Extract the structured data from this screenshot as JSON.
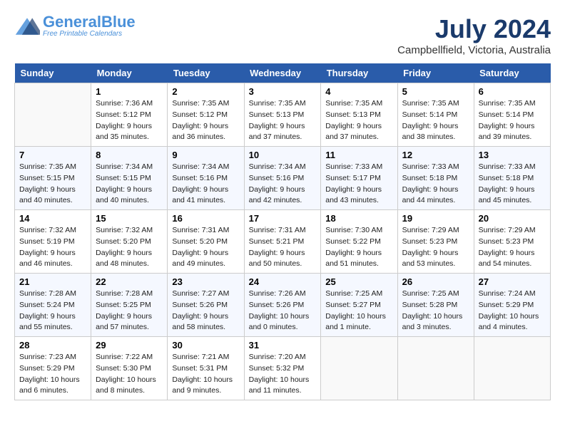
{
  "logo": {
    "text_general": "General",
    "text_blue": "Blue",
    "icon_color": "#4a90d9"
  },
  "title": {
    "month_year": "July 2024",
    "location": "Campbellfield, Victoria, Australia"
  },
  "days_of_week": [
    "Sunday",
    "Monday",
    "Tuesday",
    "Wednesday",
    "Thursday",
    "Friday",
    "Saturday"
  ],
  "weeks": [
    [
      {
        "day": "",
        "sunrise": "",
        "sunset": "",
        "daylight": ""
      },
      {
        "day": "1",
        "sunrise": "Sunrise: 7:36 AM",
        "sunset": "Sunset: 5:12 PM",
        "daylight": "Daylight: 9 hours and 35 minutes."
      },
      {
        "day": "2",
        "sunrise": "Sunrise: 7:35 AM",
        "sunset": "Sunset: 5:12 PM",
        "daylight": "Daylight: 9 hours and 36 minutes."
      },
      {
        "day": "3",
        "sunrise": "Sunrise: 7:35 AM",
        "sunset": "Sunset: 5:13 PM",
        "daylight": "Daylight: 9 hours and 37 minutes."
      },
      {
        "day": "4",
        "sunrise": "Sunrise: 7:35 AM",
        "sunset": "Sunset: 5:13 PM",
        "daylight": "Daylight: 9 hours and 37 minutes."
      },
      {
        "day": "5",
        "sunrise": "Sunrise: 7:35 AM",
        "sunset": "Sunset: 5:14 PM",
        "daylight": "Daylight: 9 hours and 38 minutes."
      },
      {
        "day": "6",
        "sunrise": "Sunrise: 7:35 AM",
        "sunset": "Sunset: 5:14 PM",
        "daylight": "Daylight: 9 hours and 39 minutes."
      }
    ],
    [
      {
        "day": "7",
        "sunrise": "Sunrise: 7:35 AM",
        "sunset": "Sunset: 5:15 PM",
        "daylight": "Daylight: 9 hours and 40 minutes."
      },
      {
        "day": "8",
        "sunrise": "Sunrise: 7:34 AM",
        "sunset": "Sunset: 5:15 PM",
        "daylight": "Daylight: 9 hours and 40 minutes."
      },
      {
        "day": "9",
        "sunrise": "Sunrise: 7:34 AM",
        "sunset": "Sunset: 5:16 PM",
        "daylight": "Daylight: 9 hours and 41 minutes."
      },
      {
        "day": "10",
        "sunrise": "Sunrise: 7:34 AM",
        "sunset": "Sunset: 5:16 PM",
        "daylight": "Daylight: 9 hours and 42 minutes."
      },
      {
        "day": "11",
        "sunrise": "Sunrise: 7:33 AM",
        "sunset": "Sunset: 5:17 PM",
        "daylight": "Daylight: 9 hours and 43 minutes."
      },
      {
        "day": "12",
        "sunrise": "Sunrise: 7:33 AM",
        "sunset": "Sunset: 5:18 PM",
        "daylight": "Daylight: 9 hours and 44 minutes."
      },
      {
        "day": "13",
        "sunrise": "Sunrise: 7:33 AM",
        "sunset": "Sunset: 5:18 PM",
        "daylight": "Daylight: 9 hours and 45 minutes."
      }
    ],
    [
      {
        "day": "14",
        "sunrise": "Sunrise: 7:32 AM",
        "sunset": "Sunset: 5:19 PM",
        "daylight": "Daylight: 9 hours and 46 minutes."
      },
      {
        "day": "15",
        "sunrise": "Sunrise: 7:32 AM",
        "sunset": "Sunset: 5:20 PM",
        "daylight": "Daylight: 9 hours and 48 minutes."
      },
      {
        "day": "16",
        "sunrise": "Sunrise: 7:31 AM",
        "sunset": "Sunset: 5:20 PM",
        "daylight": "Daylight: 9 hours and 49 minutes."
      },
      {
        "day": "17",
        "sunrise": "Sunrise: 7:31 AM",
        "sunset": "Sunset: 5:21 PM",
        "daylight": "Daylight: 9 hours and 50 minutes."
      },
      {
        "day": "18",
        "sunrise": "Sunrise: 7:30 AM",
        "sunset": "Sunset: 5:22 PM",
        "daylight": "Daylight: 9 hours and 51 minutes."
      },
      {
        "day": "19",
        "sunrise": "Sunrise: 7:29 AM",
        "sunset": "Sunset: 5:23 PM",
        "daylight": "Daylight: 9 hours and 53 minutes."
      },
      {
        "day": "20",
        "sunrise": "Sunrise: 7:29 AM",
        "sunset": "Sunset: 5:23 PM",
        "daylight": "Daylight: 9 hours and 54 minutes."
      }
    ],
    [
      {
        "day": "21",
        "sunrise": "Sunrise: 7:28 AM",
        "sunset": "Sunset: 5:24 PM",
        "daylight": "Daylight: 9 hours and 55 minutes."
      },
      {
        "day": "22",
        "sunrise": "Sunrise: 7:28 AM",
        "sunset": "Sunset: 5:25 PM",
        "daylight": "Daylight: 9 hours and 57 minutes."
      },
      {
        "day": "23",
        "sunrise": "Sunrise: 7:27 AM",
        "sunset": "Sunset: 5:26 PM",
        "daylight": "Daylight: 9 hours and 58 minutes."
      },
      {
        "day": "24",
        "sunrise": "Sunrise: 7:26 AM",
        "sunset": "Sunset: 5:26 PM",
        "daylight": "Daylight: 10 hours and 0 minutes."
      },
      {
        "day": "25",
        "sunrise": "Sunrise: 7:25 AM",
        "sunset": "Sunset: 5:27 PM",
        "daylight": "Daylight: 10 hours and 1 minute."
      },
      {
        "day": "26",
        "sunrise": "Sunrise: 7:25 AM",
        "sunset": "Sunset: 5:28 PM",
        "daylight": "Daylight: 10 hours and 3 minutes."
      },
      {
        "day": "27",
        "sunrise": "Sunrise: 7:24 AM",
        "sunset": "Sunset: 5:29 PM",
        "daylight": "Daylight: 10 hours and 4 minutes."
      }
    ],
    [
      {
        "day": "28",
        "sunrise": "Sunrise: 7:23 AM",
        "sunset": "Sunset: 5:29 PM",
        "daylight": "Daylight: 10 hours and 6 minutes."
      },
      {
        "day": "29",
        "sunrise": "Sunrise: 7:22 AM",
        "sunset": "Sunset: 5:30 PM",
        "daylight": "Daylight: 10 hours and 8 minutes."
      },
      {
        "day": "30",
        "sunrise": "Sunrise: 7:21 AM",
        "sunset": "Sunset: 5:31 PM",
        "daylight": "Daylight: 10 hours and 9 minutes."
      },
      {
        "day": "31",
        "sunrise": "Sunrise: 7:20 AM",
        "sunset": "Sunset: 5:32 PM",
        "daylight": "Daylight: 10 hours and 11 minutes."
      },
      {
        "day": "",
        "sunrise": "",
        "sunset": "",
        "daylight": ""
      },
      {
        "day": "",
        "sunrise": "",
        "sunset": "",
        "daylight": ""
      },
      {
        "day": "",
        "sunrise": "",
        "sunset": "",
        "daylight": ""
      }
    ]
  ]
}
